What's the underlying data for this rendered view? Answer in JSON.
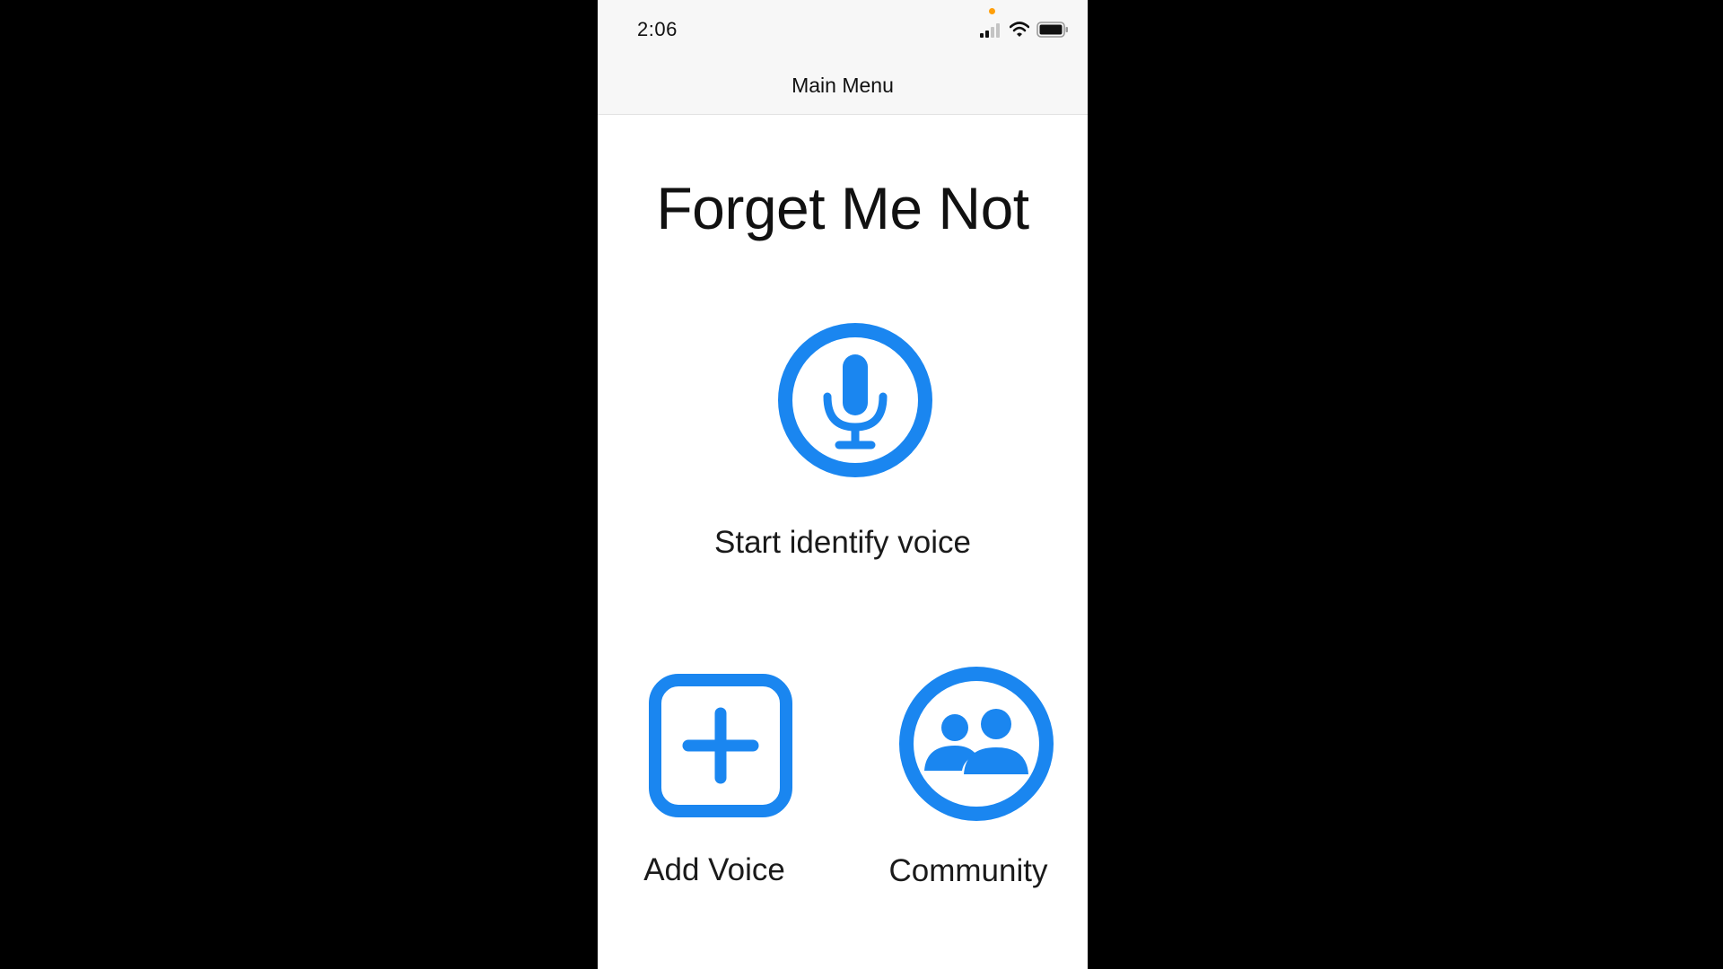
{
  "status_bar": {
    "time": "2:06"
  },
  "nav": {
    "title": "Main Menu"
  },
  "app": {
    "title": "Forget Me Not"
  },
  "options": {
    "identify": {
      "label": "Start identify voice",
      "icon": "microphone-circle-icon"
    },
    "add": {
      "label": "Add Voice",
      "icon": "plus-square-icon"
    },
    "community": {
      "label": "Community",
      "icon": "people-circle-icon"
    }
  },
  "colors": {
    "accent": "#1a86f0",
    "background": "#ffffff",
    "bar_background": "#f7f7f7",
    "letterbox": "#000000"
  }
}
